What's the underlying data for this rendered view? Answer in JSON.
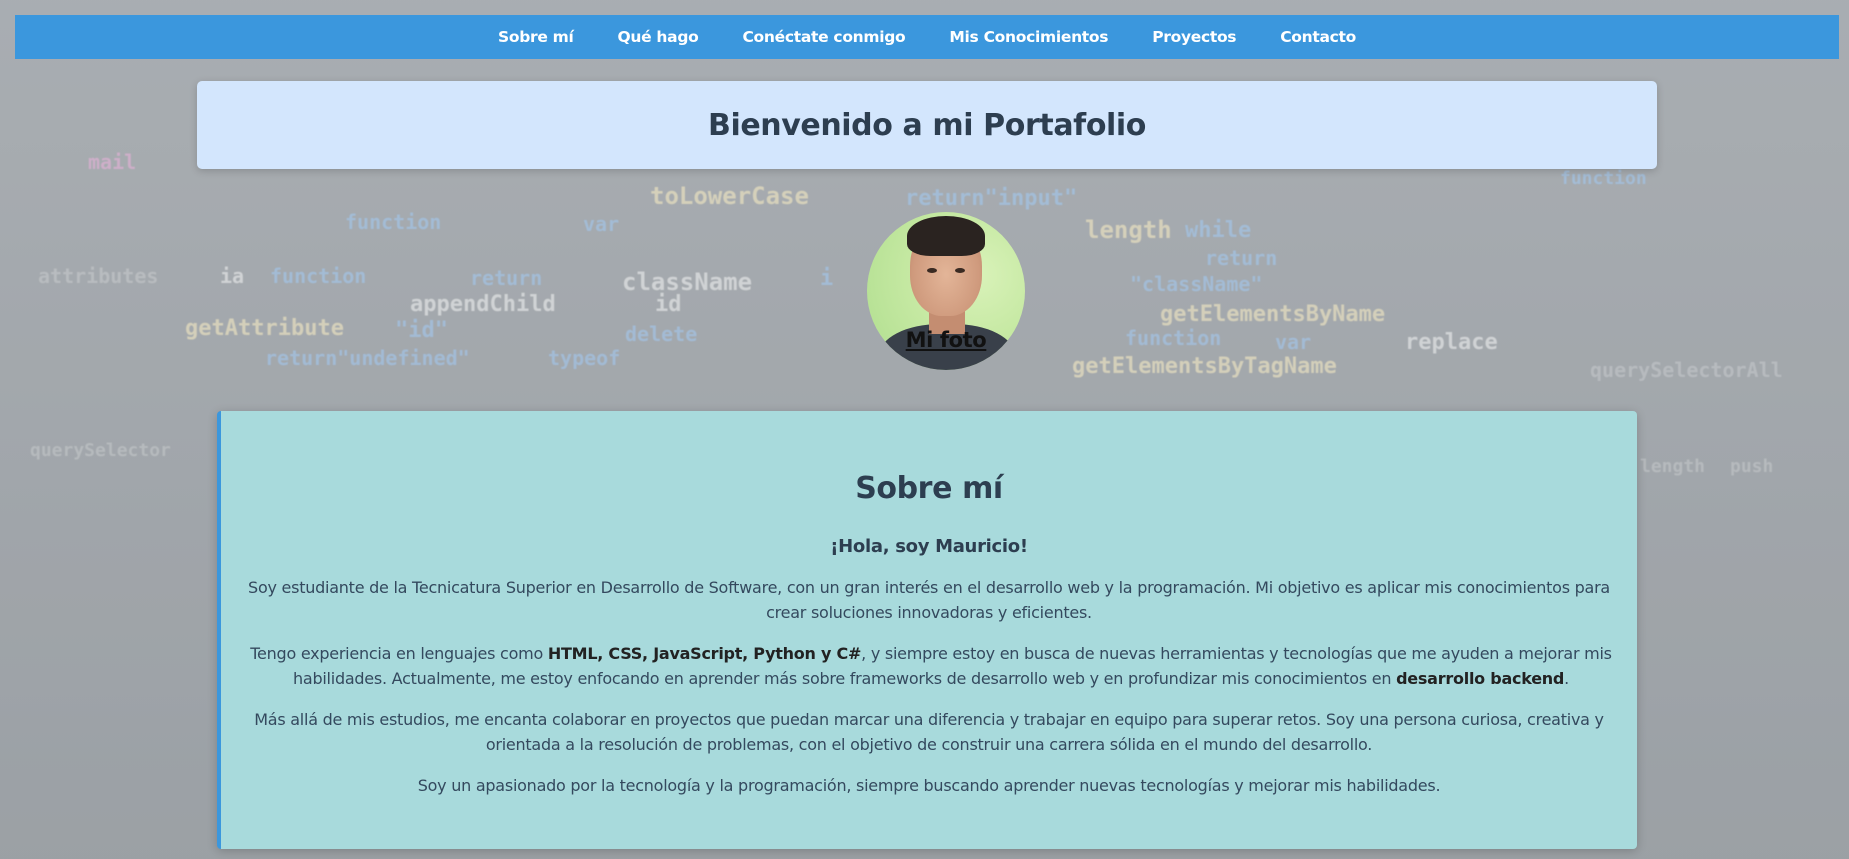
{
  "nav": {
    "items": [
      {
        "label": "Sobre mí"
      },
      {
        "label": "Qué hago"
      },
      {
        "label": "Conéctate conmigo"
      },
      {
        "label": "Mis Conocimientos"
      },
      {
        "label": "Proyectos"
      },
      {
        "label": "Contacto"
      }
    ]
  },
  "header": {
    "title": "Bienvenido a mi Portafolio"
  },
  "profile": {
    "photo_caption": "Mi foto"
  },
  "about": {
    "title": "Sobre mí",
    "greeting": "¡Hola, soy Mauricio!",
    "p1": "Soy estudiante de la Tecnicatura Superior en Desarrollo de Software, con un gran interés en el desarrollo web y la programación. Mi objetivo es aplicar mis conocimientos para crear soluciones innovadoras y eficientes.",
    "p2_a": "Tengo experiencia en lenguajes como ",
    "p2_bold1": "HTML, CSS, JavaScript, Python y C#",
    "p2_b": ", y siempre estoy en busca de nuevas herramientas y tecnologías que me ayuden a mejorar mis habilidades. Actualmente, me estoy enfocando en aprender más sobre frameworks de desarrollo web y en profundizar mis conocimientos en ",
    "p2_bold2": "desarrollo backend",
    "p2_c": ".",
    "p3": "Más allá de mis estudios, me encanta colaborar en proyectos que puedan marcar una diferencia y trabajar en equipo para superar retos. Soy una persona curiosa, creativa y orientada a la resolución de problemas, con el objetivo de construir una carrera sólida en el mundo del desarrollo.",
    "p4": "Soy un apasionado por la tecnología y la programación, siempre buscando aprender nuevas tecnologías y mejorar mis habilidades."
  },
  "background_code": [
    "toLowerCase",
    "return\"input\"",
    "function",
    "var",
    "length",
    "while",
    "return",
    "className",
    "appendChild",
    "id",
    "getElementsByName",
    "getAttribute",
    "\"id\"",
    "delete",
    "function",
    "var",
    "replace",
    "return\"undefined\"",
    "typeof",
    "getElementsByTagName",
    "querySelectorAll",
    "attributes",
    "ia",
    "function",
    "return",
    "i",
    "\"className\"",
    "querySelector",
    "length",
    "push",
    "function",
    "mail"
  ],
  "colors": {
    "nav_bg": "#3b97dd",
    "header_bg": "#d3e6fd",
    "about_bg": "#a8dadc",
    "about_accent": "#3b97dd",
    "heading_text": "#2d3e50"
  }
}
